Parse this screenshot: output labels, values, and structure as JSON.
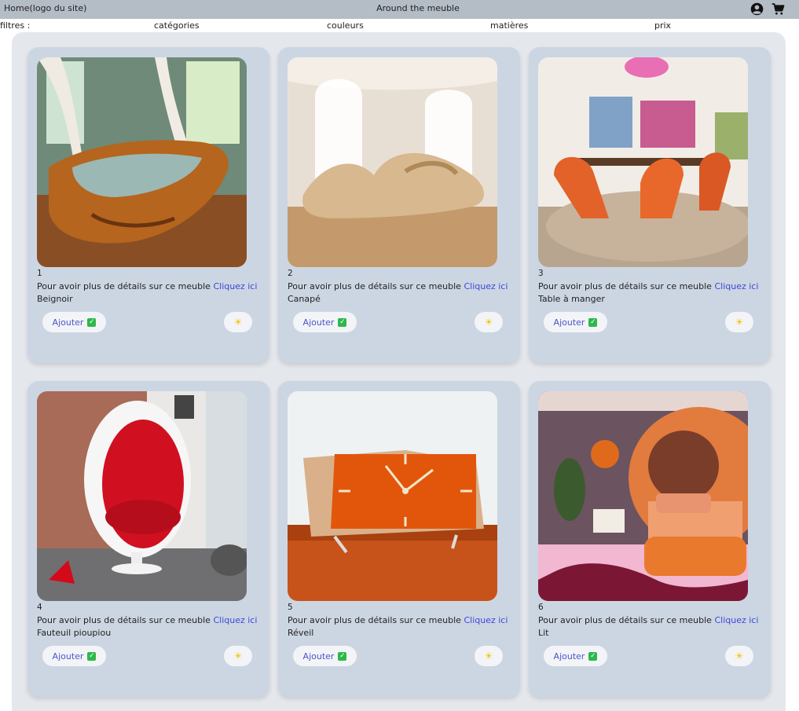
{
  "header": {
    "home_label": "Home(logo du site)",
    "site_title": "Around the meuble",
    "account_icon": "account-circle-icon",
    "cart_icon": "shopping-cart-icon"
  },
  "filters": {
    "label": "filtres :",
    "items": [
      "catégories",
      "couleurs",
      "matières",
      "prix"
    ]
  },
  "products": [
    {
      "number": "1",
      "detail_text": "Pour avoir plus de détails sur ce meuble",
      "link_text": "Cliquez ici",
      "name": "Beignoir",
      "add_label": "Ajouter",
      "check_icon": "check-box-icon",
      "sun_icon": "sun-icon"
    },
    {
      "number": "2",
      "detail_text": "Pour avoir plus de détails sur ce meuble",
      "link_text": "Cliquez ici",
      "name": "Canapé",
      "add_label": "Ajouter",
      "check_icon": "check-box-icon",
      "sun_icon": "sun-icon"
    },
    {
      "number": "3",
      "detail_text": "Pour avoir plus de détails sur ce meuble",
      "link_text": "Cliquez ici",
      "name": "Table à manger",
      "add_label": "Ajouter",
      "check_icon": "check-box-icon",
      "sun_icon": "sun-icon"
    },
    {
      "number": "4",
      "detail_text": "Pour avoir plus de détails sur ce meuble",
      "link_text": "Cliquez ici",
      "name": "Fauteuil pioupiou",
      "add_label": "Ajouter",
      "check_icon": "check-box-icon",
      "sun_icon": "sun-icon"
    },
    {
      "number": "5",
      "detail_text": "Pour avoir plus de détails sur ce meuble",
      "link_text": "Cliquez ici",
      "name": "Réveil",
      "add_label": "Ajouter",
      "check_icon": "check-box-icon",
      "sun_icon": "sun-icon"
    },
    {
      "number": "6",
      "detail_text": "Pour avoir plus de détails sur ce meuble",
      "link_text": "Cliquez ici",
      "name": "Lit",
      "add_label": "Ajouter",
      "check_icon": "check-box-icon",
      "sun_icon": "sun-icon"
    }
  ],
  "colors": {
    "header_bg": "#b4bcc6",
    "panel_bg": "#e4e7ec",
    "card_bg": "#ccd6e3",
    "link": "#3b47d6",
    "check_green": "#2db84b",
    "sun_yellow": "#f2c200"
  }
}
